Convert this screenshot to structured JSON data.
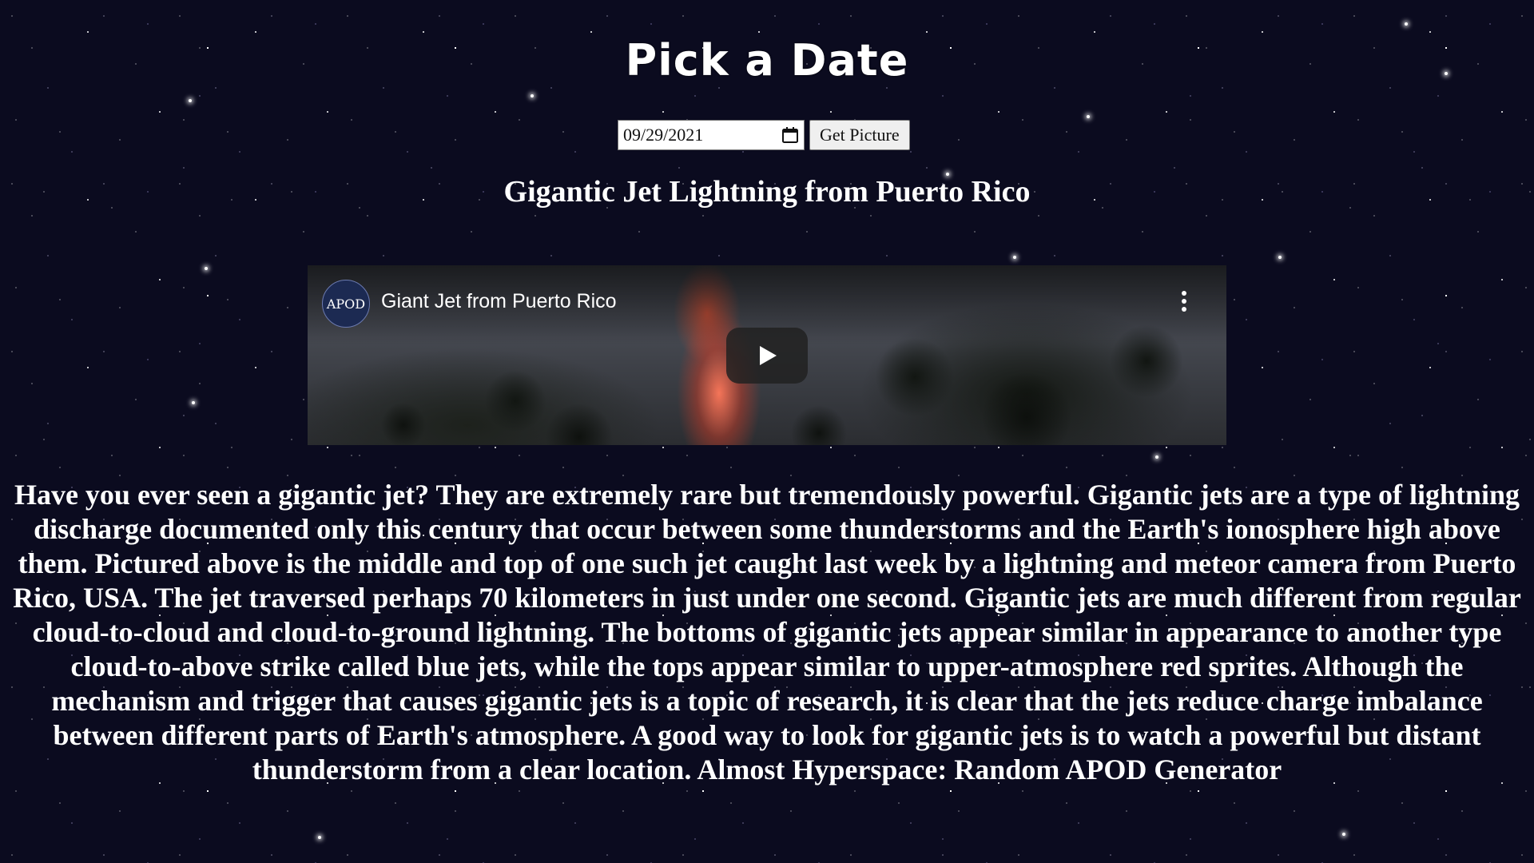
{
  "page": {
    "heading": "Pick a Date"
  },
  "controls": {
    "date_value": "09/29/2021",
    "calendar_icon": "calendar-icon",
    "button_label": "Get Picture"
  },
  "apod": {
    "title": "Gigantic Jet Lightning from Puerto Rico",
    "video": {
      "channel_avatar_text": "APOD",
      "title": "Giant Jet from Puerto Rico",
      "menu_icon": "kebab-menu-icon",
      "play_icon": "play-icon"
    },
    "explanation": "Have you ever seen a gigantic jet? They are extremely rare but tremendously powerful. Gigantic jets are a type of lightning discharge documented only this century that occur between some thunderstorms and the Earth's ionosphere high above them. Pictured above is the middle and top of one such jet caught last week by a lightning and meteor camera from Puerto Rico, USA. The jet traversed perhaps 70 kilometers in just under one second. Gigantic jets are much different from regular cloud-to-cloud and cloud-to-ground lightning. The bottoms of gigantic jets appear similar in appearance to another type cloud-to-above strike called blue jets, while the tops appear similar to upper-atmosphere red sprites. Although the mechanism and trigger that causes gigantic jets is a topic of research, it is clear that the jets reduce charge imbalance between different parts of Earth's atmosphere. A good way to look for gigantic jets is to watch a powerful but distant thunderstorm from a clear location. Almost Hyperspace: Random APOD Generator"
  },
  "colors": {
    "background": "#0b0b1f",
    "text": "#ffffff",
    "youtube_play": "#212121"
  }
}
